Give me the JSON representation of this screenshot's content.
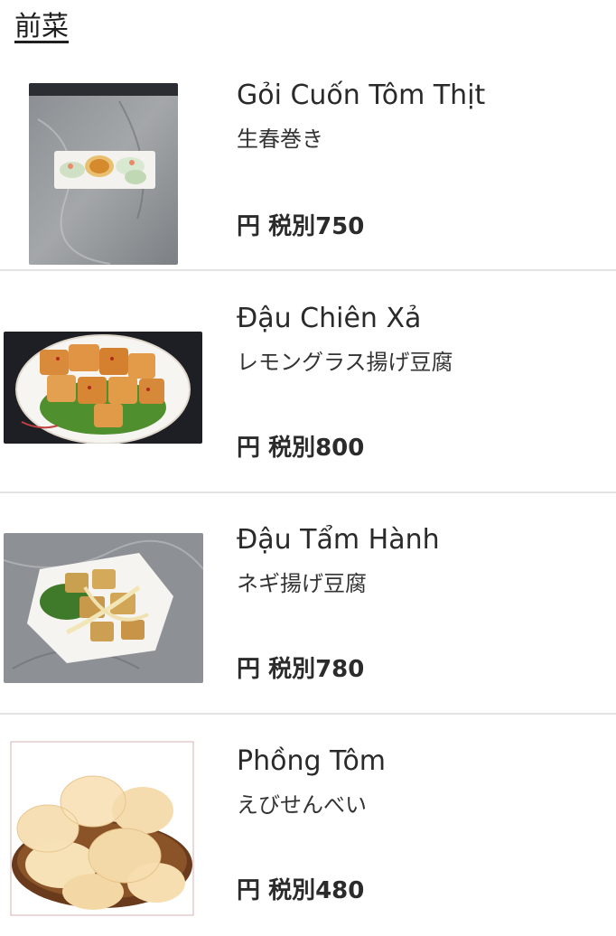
{
  "section": {
    "title": "前菜"
  },
  "items": [
    {
      "name": "Gỏi Cuốn Tôm Thịt",
      "description": "生春巻き",
      "currency": "円",
      "tax_label": "税別",
      "price": "750"
    },
    {
      "name": "Đậu Chiên Xả",
      "description": "レモングラス揚げ豆腐",
      "currency": "円",
      "tax_label": "税別",
      "price": "800"
    },
    {
      "name": "Đậu Tẩm Hành",
      "description": "ネギ揚げ豆腐",
      "currency": "円",
      "tax_label": "税別",
      "price": "780"
    },
    {
      "name": "Phồng Tôm",
      "description": "えびせんべい",
      "currency": "円",
      "tax_label": "税別",
      "price": "480"
    }
  ]
}
